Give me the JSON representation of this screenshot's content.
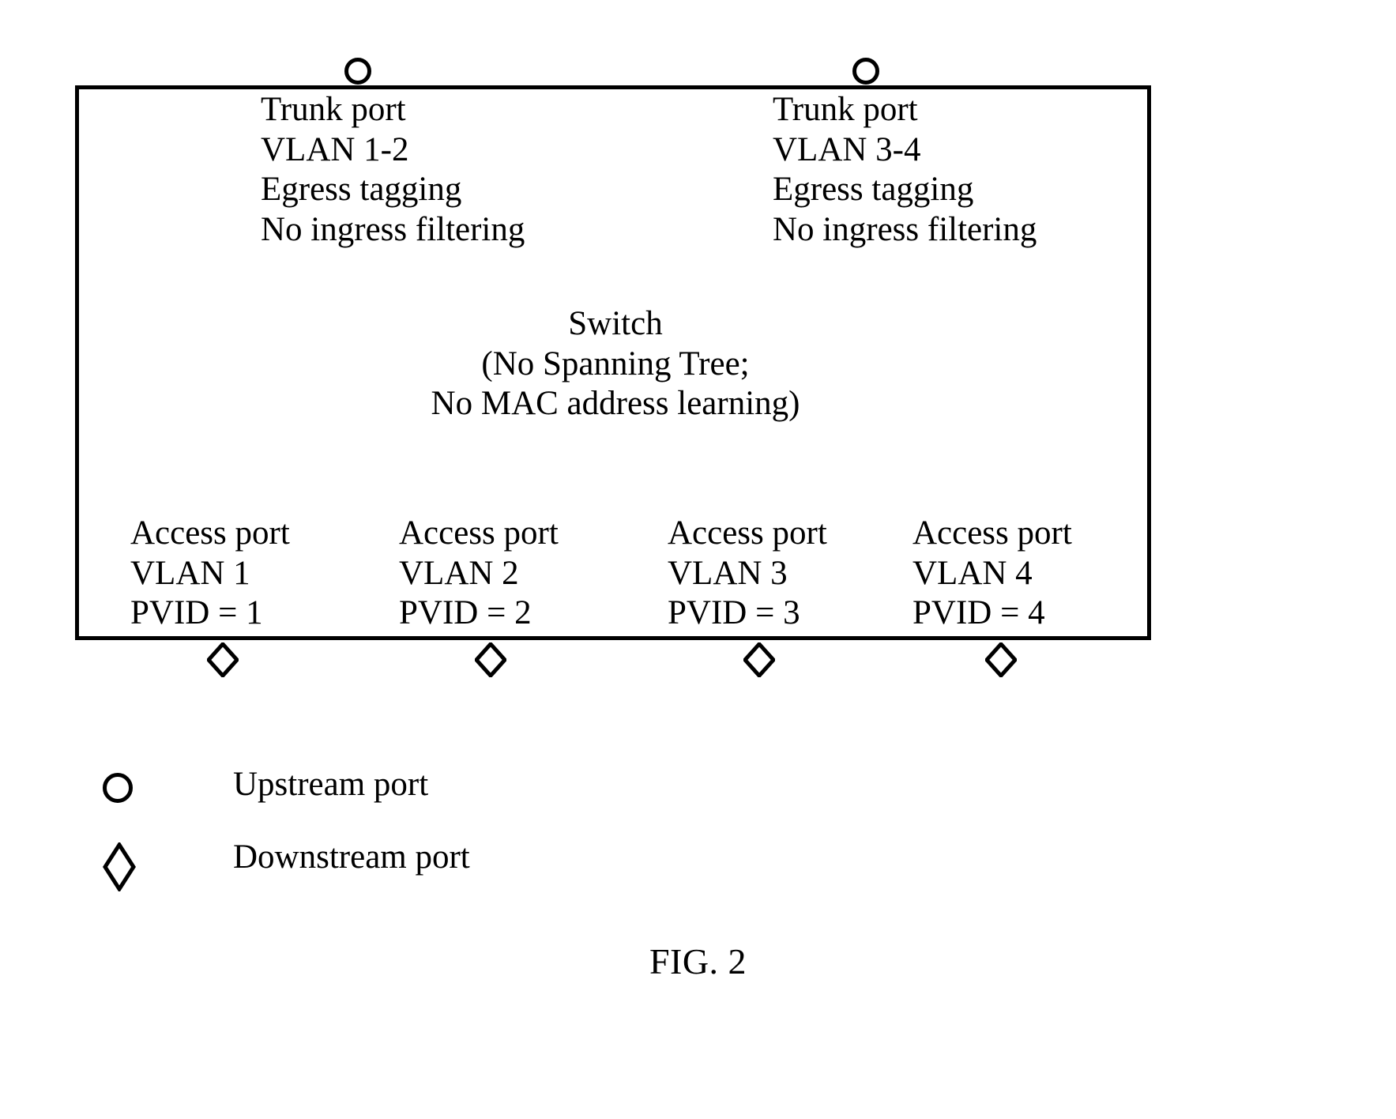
{
  "figure": {
    "caption": "FIG. 2"
  },
  "switch": {
    "title": "Switch",
    "note_line_1": "(No Spanning Tree;",
    "note_line_2": "No MAC address learning)"
  },
  "trunk_ports": [
    {
      "id": "trunk-left",
      "port_type": "Trunk port",
      "vlan": "VLAN 1-2",
      "tagging": "Egress tagging",
      "filtering": "No ingress filtering",
      "marker": "upstream-port-circle"
    },
    {
      "id": "trunk-right",
      "port_type": "Trunk port",
      "vlan": "VLAN 3-4",
      "tagging": "Egress tagging",
      "filtering": "No ingress filtering",
      "marker": "upstream-port-circle"
    }
  ],
  "access_ports": [
    {
      "id": "access-1",
      "port_type": "Access port",
      "vlan": "VLAN 1",
      "pvid": "PVID = 1",
      "marker": "downstream-port-diamond"
    },
    {
      "id": "access-2",
      "port_type": "Access port",
      "vlan": "VLAN 2",
      "pvid": "PVID = 2",
      "marker": "downstream-port-diamond"
    },
    {
      "id": "access-3",
      "port_type": "Access port",
      "vlan": "VLAN 3",
      "pvid": "PVID = 3",
      "marker": "downstream-port-diamond"
    },
    {
      "id": "access-4",
      "port_type": "Access port",
      "vlan": "VLAN 4",
      "pvid": "PVID = 4",
      "marker": "downstream-port-diamond"
    }
  ],
  "legend": [
    {
      "symbol": "circle",
      "label": "Upstream port"
    },
    {
      "symbol": "diamond",
      "label": "Downstream port"
    }
  ],
  "colors": {
    "ink": "#000000",
    "paper": "#ffffff"
  }
}
